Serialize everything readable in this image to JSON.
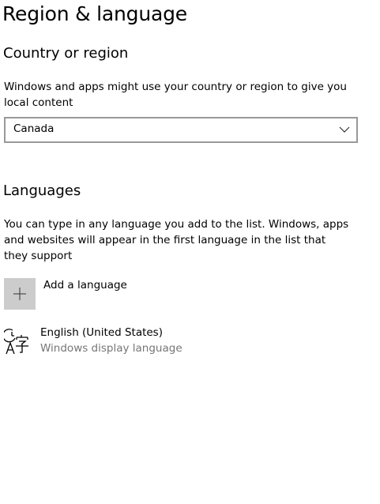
{
  "page": {
    "title": "Region & language"
  },
  "country_region": {
    "heading": "Country or region",
    "description": "Windows and apps might use your country or region to give you local content",
    "selected": "Canada",
    "chevron_icon": "chevron-down-icon"
  },
  "languages": {
    "heading": "Languages",
    "description": "You can type in any language you add to the list. Windows, apps and websites will appear in the first language in the list that they support",
    "add_label": "Add a language",
    "add_icon": "plus-icon",
    "items": [
      {
        "name": "English (United States)",
        "subtitle": "Windows display language",
        "icon": "language-display-icon"
      }
    ]
  },
  "colors": {
    "add_tile_bg": "#cccccc",
    "dropdown_border": "#999999",
    "secondary_text": "#767676"
  }
}
